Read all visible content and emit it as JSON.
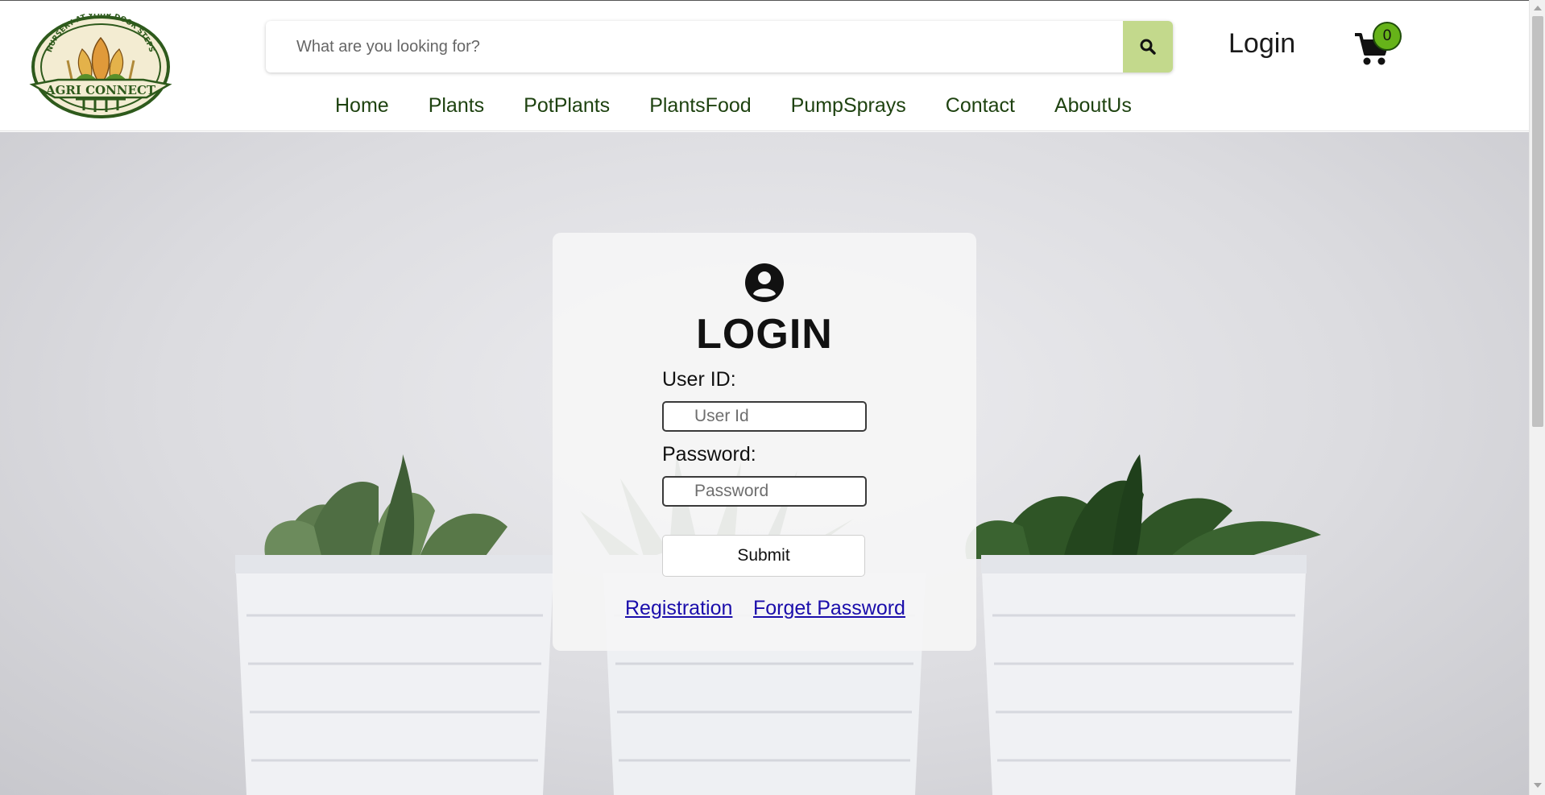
{
  "header": {
    "logo": {
      "top_text": "NURSERY AT YOUR DOOR STEPS",
      "name": "AGRI CONNECT"
    },
    "search": {
      "placeholder": "What are you looking for?",
      "button_icon": "search-icon"
    },
    "login_label": "Login",
    "cart": {
      "icon": "cart-icon",
      "count": "0"
    },
    "nav": [
      {
        "label": "Home"
      },
      {
        "label": "Plants"
      },
      {
        "label": "PotPlants"
      },
      {
        "label": "PlantsFood"
      },
      {
        "label": "PumpSprays"
      },
      {
        "label": "Contact"
      },
      {
        "label": "AboutUs"
      }
    ]
  },
  "login_card": {
    "icon": "user-circle-icon",
    "title": "LOGIN",
    "user_id_label": "User ID:",
    "user_id_placeholder": "User Id",
    "password_label": "Password:",
    "password_placeholder": "Password",
    "submit_label": "Submit",
    "registration_link": "Registration",
    "forget_password_link": "Forget Password"
  },
  "colors": {
    "nav_text": "#1e4210",
    "search_button": "#c3d98c",
    "cart_badge": "#66b319",
    "link": "#1a0dab"
  }
}
